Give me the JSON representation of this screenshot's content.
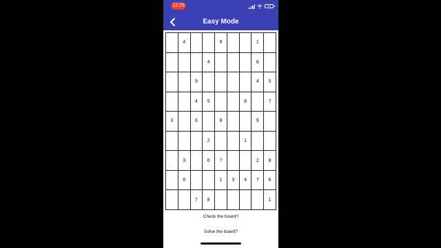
{
  "status_bar": {
    "time": "12:25",
    "battery": "84"
  },
  "app_bar": {
    "title": "Easy Mode",
    "back_icon": "chevron-left-icon"
  },
  "board": {
    "rows": [
      [
        "",
        "4",
        "",
        "",
        "9",
        "",
        "",
        "1",
        ""
      ],
      [
        "",
        "",
        "",
        "4",
        "",
        "",
        "",
        "8",
        ""
      ],
      [
        "",
        "",
        "9",
        "",
        "",
        "",
        "",
        "4",
        "5"
      ],
      [
        "",
        "",
        "4",
        "5",
        "",
        "",
        "8",
        "",
        "7"
      ],
      [
        "3",
        "",
        "6",
        "",
        "8",
        "",
        "",
        "9",
        ""
      ],
      [
        "",
        "",
        "",
        "2",
        "",
        "",
        "1",
        "",
        ""
      ],
      [
        "",
        "3",
        "",
        "6",
        "7",
        "",
        "",
        "2",
        "8"
      ],
      [
        "",
        "8",
        "",
        "",
        "1",
        "3",
        "4",
        "7",
        "6"
      ],
      [
        "",
        "",
        "7",
        "8",
        "",
        "",
        "",
        "",
        "1"
      ]
    ]
  },
  "actions": {
    "check": "Check the board?",
    "solve": "Solve the board?"
  },
  "colors": {
    "app_bar": "#3a40b3",
    "time_pill": "#e23b3b",
    "background": "#000000"
  }
}
